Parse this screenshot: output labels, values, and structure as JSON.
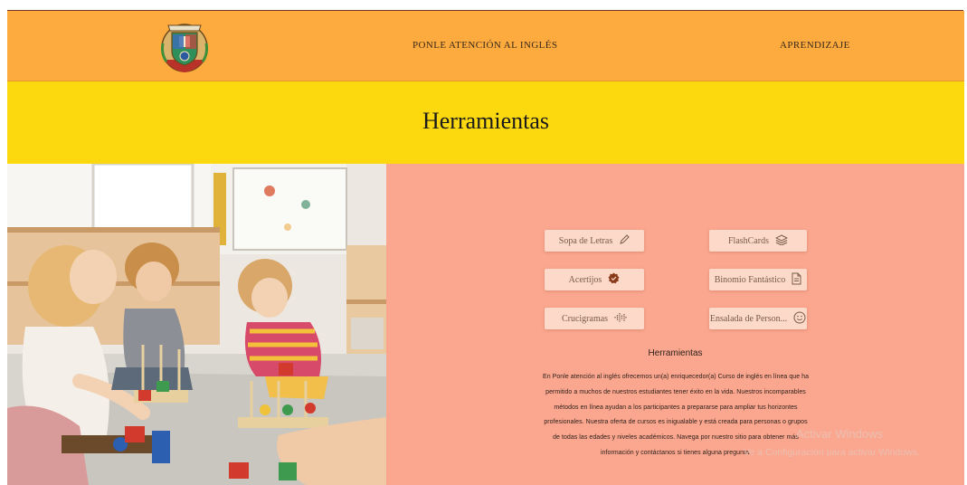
{
  "nav": {
    "links": [
      "PONLE ATENCIÓN AL INGLÉS",
      "APRENDIZAJE"
    ]
  },
  "banner": {
    "title": "Herramientas"
  },
  "tools": [
    {
      "label": "Sopa de Letras",
      "icon": "pencil-icon"
    },
    {
      "label": "FlashCards",
      "icon": "layers-icon"
    },
    {
      "label": "Acertijos",
      "icon": "seal-check-icon"
    },
    {
      "label": "Binomio Fantástico",
      "icon": "document-icon"
    },
    {
      "label": "Crucigramas",
      "icon": "soundwave-icon"
    },
    {
      "label": "Ensalada de Person...",
      "icon": "smiley-icon"
    }
  ],
  "info": {
    "title": "Herramientas",
    "text": "En Ponle atención al inglés ofrecemos un(a) enriquecedor(a) Curso de inglés en línea que ha permitido a muchos de nuestros estudiantes tener éxito en la vida. Nuestros incomparables métodos en línea ayudan a los participantes a prepararse para ampliar tus horizontes profesionales. Nuestra oferta de cursos es inigualable y está creada para personas o grupos de todas las edades y niveles académicos. Navega por nuestro sitio para obtener más información y contáctanos si tienes alguna pregunta."
  },
  "watermark": {
    "line1": "Activar Windows",
    "line2": "Ve a Configuración para activar Windows."
  },
  "colors": {
    "nav_bg": "#fdaa3e",
    "banner_bg": "#fcd80f",
    "panel_bg": "#fba68e",
    "button_bg": "#fcd9c9"
  }
}
